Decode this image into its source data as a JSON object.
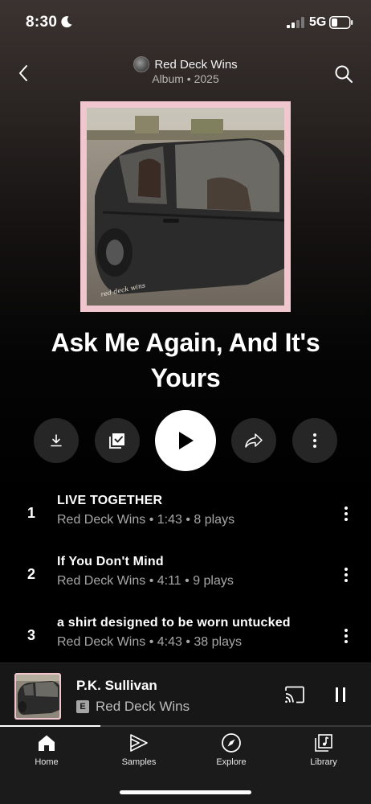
{
  "status_bar": {
    "time": "8:30",
    "network": "5G"
  },
  "header": {
    "artist": "Red Deck Wins",
    "subtitle": "Album • 2025",
    "back_icon": "chevron-left-icon",
    "search_icon": "search-icon"
  },
  "album": {
    "title": "Ask Me Again, And It's Yours",
    "cover_frame_color": "#f1c7cf"
  },
  "actions": {
    "download_icon": "download-icon",
    "save_icon": "library-check-icon",
    "play_icon": "play-icon",
    "share_icon": "share-icon",
    "more_icon": "more-vertical-icon"
  },
  "tracks": [
    {
      "number": "1",
      "title": "LIVE TOGETHER",
      "meta": "Red Deck Wins • 1:43 • 8 plays"
    },
    {
      "number": "2",
      "title": "If You Don't Mind",
      "meta": "Red Deck Wins • 4:11 • 9 plays"
    },
    {
      "number": "3",
      "title": "a shirt designed to be worn untucked",
      "meta": "Red Deck Wins • 4:43 • 38 plays"
    }
  ],
  "mini_player": {
    "title": "P.K. Sullivan",
    "explicit_badge": "E",
    "artist": "Red Deck Wins",
    "progress": 0.27,
    "cast_icon": "cast-icon",
    "pause_icon": "pause-icon"
  },
  "nav": {
    "items": [
      {
        "label": "Home",
        "icon": "home-icon"
      },
      {
        "label": "Samples",
        "icon": "samples-icon"
      },
      {
        "label": "Explore",
        "icon": "compass-icon"
      },
      {
        "label": "Library",
        "icon": "library-icon"
      }
    ]
  },
  "colors": {
    "accent": "#ffffff",
    "background": "#000000",
    "secondary_text": "#a7a7a7"
  }
}
